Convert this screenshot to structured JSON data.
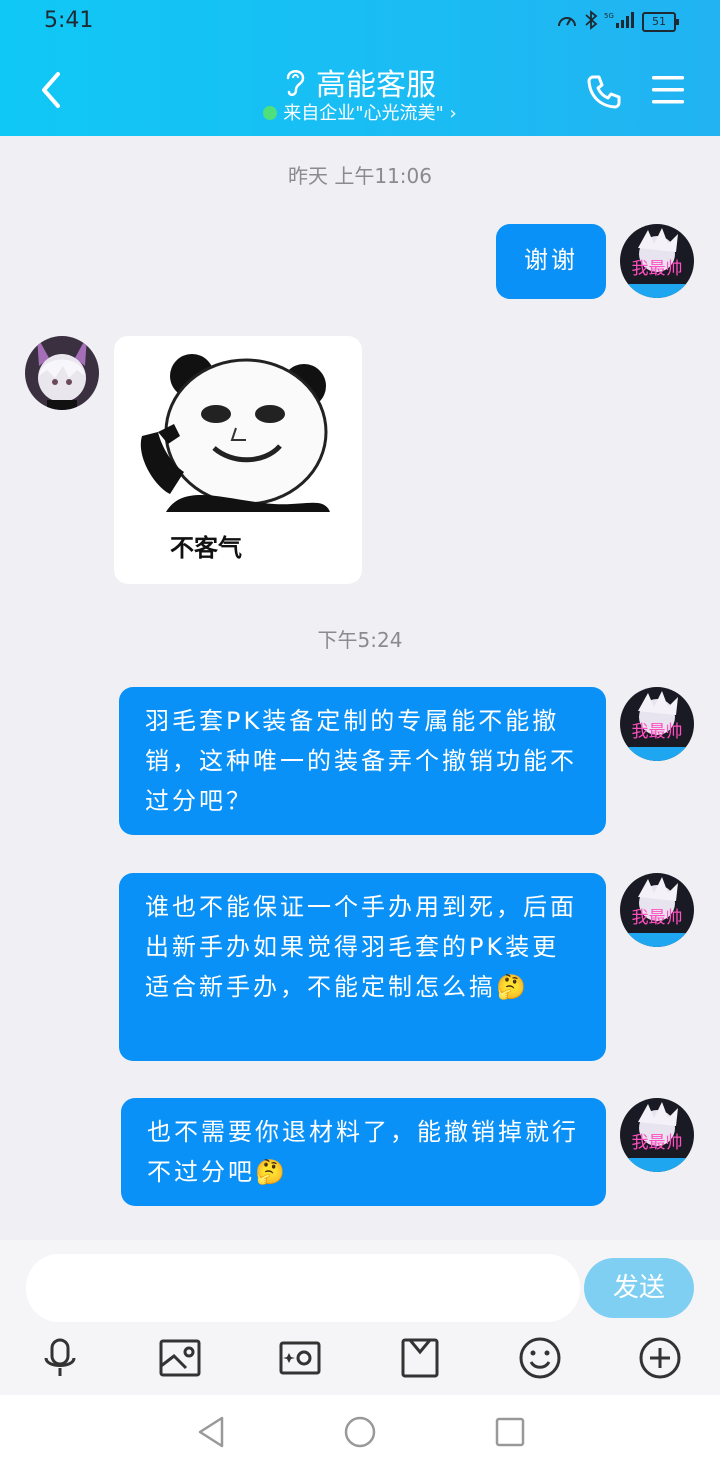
{
  "status": {
    "time": "5:41",
    "battery": "51"
  },
  "header": {
    "title": "高能客服",
    "subtitle": "来自企业\"心光流美\" ›"
  },
  "chat": {
    "timestamps": [
      "昨天 上午11:06",
      "下午5:24"
    ],
    "messages": [
      {
        "sender": "me",
        "text": "谢谢"
      },
      {
        "sender": "service",
        "sticker_caption": "不客气"
      },
      {
        "sender": "me",
        "text": "羽毛套PK装备定制的专属能不能撤销，这种唯一的装备弄个撤销功能不过分吧？"
      },
      {
        "sender": "me",
        "text": "谁也不能保证一个手办用到死，后面出新手办如果觉得羽毛套的PK装更适合新手办，不能定制怎么搞🤔"
      },
      {
        "sender": "me",
        "text": "也不需要你退材料了，能撤销掉就行不过分吧🤔"
      }
    ],
    "my_avatar_text": "我最帅"
  },
  "input": {
    "placeholder": "",
    "send_label": "发送"
  },
  "toolbar": [
    "mic-icon",
    "image-icon",
    "camera-icon",
    "file-icon",
    "emoji-icon",
    "plus-icon"
  ],
  "colors": {
    "header_start": "#10c8f5",
    "header_end": "#22b3f2",
    "bubble": "#0a91f7",
    "send": "#7fcff3"
  }
}
